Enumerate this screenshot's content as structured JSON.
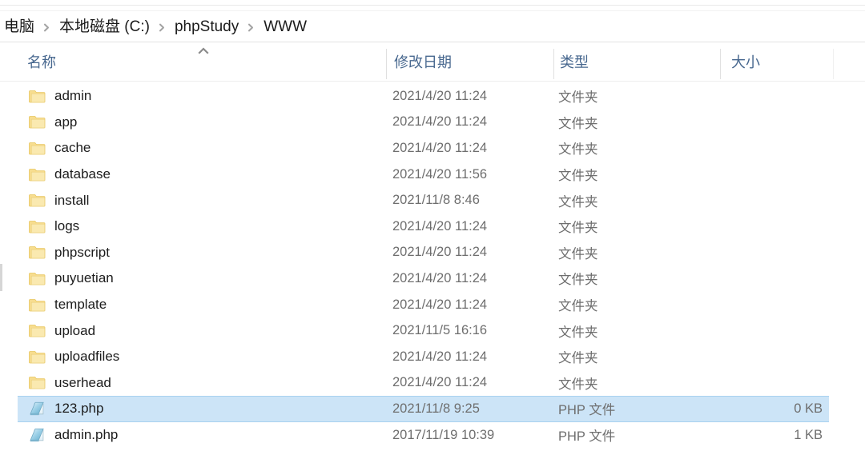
{
  "window": {
    "app": "file-explorer"
  },
  "breadcrumb": {
    "name": "address-breadcrumb",
    "separator": "chevron-right-icon",
    "items": [
      {
        "label": "电脑"
      },
      {
        "label": "本地磁盘 (C:)"
      },
      {
        "label": "phpStudy"
      },
      {
        "label": "WWW"
      }
    ]
  },
  "columns": {
    "sort": {
      "column": "名称",
      "direction": "ascending",
      "icon": "sort-ascending-caret"
    },
    "headers": [
      {
        "key": "name",
        "label": "名称"
      },
      {
        "key": "date",
        "label": "修改日期"
      },
      {
        "key": "type",
        "label": "类型"
      },
      {
        "key": "size",
        "label": "大小"
      }
    ]
  },
  "colors": {
    "selection_fill": "#cce4f7",
    "selection_border": "#a8d2f0",
    "header_text": "#48688f",
    "row_text": "#1c1c1c",
    "meta_text": "#6e6e6e",
    "folder_icon": "#f6d87c"
  },
  "files": {
    "name": "file-list",
    "rows": [
      {
        "name": "admin",
        "date": "2021/4/20 11:24",
        "type": "文件夹",
        "size": "",
        "icon": "folder-icon",
        "selected": false
      },
      {
        "name": "app",
        "date": "2021/4/20 11:24",
        "type": "文件夹",
        "size": "",
        "icon": "folder-icon",
        "selected": false
      },
      {
        "name": "cache",
        "date": "2021/4/20 11:24",
        "type": "文件夹",
        "size": "",
        "icon": "folder-icon",
        "selected": false
      },
      {
        "name": "database",
        "date": "2021/4/20 11:56",
        "type": "文件夹",
        "size": "",
        "icon": "folder-icon",
        "selected": false
      },
      {
        "name": "install",
        "date": "2021/11/8 8:46",
        "type": "文件夹",
        "size": "",
        "icon": "folder-icon",
        "selected": false
      },
      {
        "name": "logs",
        "date": "2021/4/20 11:24",
        "type": "文件夹",
        "size": "",
        "icon": "folder-icon",
        "selected": false
      },
      {
        "name": "phpscript",
        "date": "2021/4/20 11:24",
        "type": "文件夹",
        "size": "",
        "icon": "folder-icon",
        "selected": false
      },
      {
        "name": "puyuetian",
        "date": "2021/4/20 11:24",
        "type": "文件夹",
        "size": "",
        "icon": "folder-icon",
        "selected": false
      },
      {
        "name": "template",
        "date": "2021/4/20 11:24",
        "type": "文件夹",
        "size": "",
        "icon": "folder-icon",
        "selected": false
      },
      {
        "name": "upload",
        "date": "2021/11/5 16:16",
        "type": "文件夹",
        "size": "",
        "icon": "folder-icon",
        "selected": false
      },
      {
        "name": "uploadfiles",
        "date": "2021/4/20 11:24",
        "type": "文件夹",
        "size": "",
        "icon": "folder-icon",
        "selected": false
      },
      {
        "name": "userhead",
        "date": "2021/4/20 11:24",
        "type": "文件夹",
        "size": "",
        "icon": "folder-icon",
        "selected": false
      },
      {
        "name": "123.php",
        "date": "2021/11/8 9:25",
        "type": "PHP 文件",
        "size": "0 KB",
        "icon": "php-file-icon",
        "selected": true
      },
      {
        "name": "admin.php",
        "date": "2017/11/19 10:39",
        "type": "PHP 文件",
        "size": "1 KB",
        "icon": "php-file-icon",
        "selected": false
      }
    ]
  }
}
